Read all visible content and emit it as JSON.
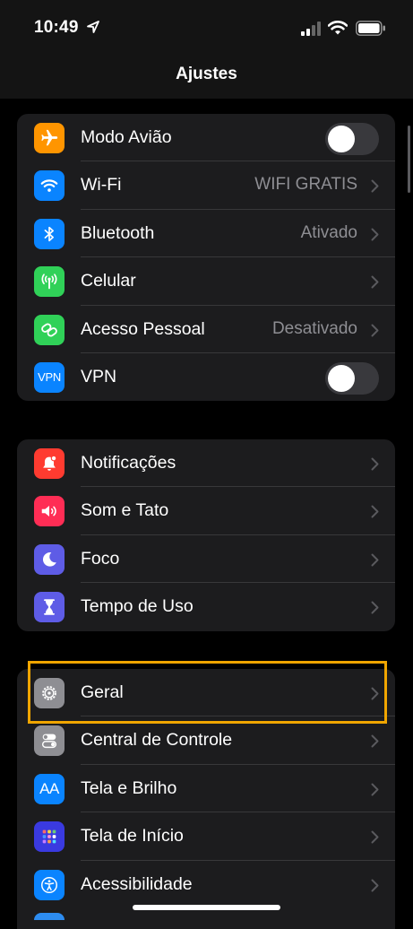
{
  "status_bar": {
    "time": "10:49",
    "icons": [
      "location-arrow-icon",
      "cellular-signal-icon",
      "wifi-status-icon",
      "battery-icon"
    ]
  },
  "nav": {
    "title": "Ajustes"
  },
  "groups": [
    {
      "rows": [
        {
          "label": "Modo Avião",
          "icon": "airplane-icon",
          "icon_color": "#ff9500",
          "control": "toggle",
          "toggle_on": false
        },
        {
          "label": "Wi-Fi",
          "icon": "wifi-icon",
          "icon_color": "#0a84ff",
          "value": "WIFI GRATIS"
        },
        {
          "label": "Bluetooth",
          "icon": "bluetooth-icon",
          "icon_color": "#0a84ff",
          "value": "Ativado"
        },
        {
          "label": "Celular",
          "icon": "antenna-icon",
          "icon_color": "#30d158",
          "value": ""
        },
        {
          "label": "Acesso Pessoal",
          "icon": "hotspot-icon",
          "icon_color": "#30d158",
          "value": "Desativado"
        },
        {
          "label": "VPN",
          "icon": "vpn-icon",
          "icon_text": "VPN",
          "icon_color": "#0a84ff",
          "control": "toggle",
          "toggle_on": false
        }
      ]
    },
    {
      "rows": [
        {
          "label": "Notificações",
          "icon": "bell-icon",
          "icon_color": "#ff3b30"
        },
        {
          "label": "Som e Tato",
          "icon": "speaker-icon",
          "icon_color": "#ff2d55"
        },
        {
          "label": "Foco",
          "icon": "moon-icon",
          "icon_color": "#5e5ce6"
        },
        {
          "label": "Tempo de Uso",
          "icon": "hourglass-icon",
          "icon_color": "#5e5ce6"
        }
      ]
    },
    {
      "rows": [
        {
          "label": "Geral",
          "icon": "gear-icon",
          "icon_color": "#8e8e93"
        },
        {
          "label": "Central de Controle",
          "icon": "switches-icon",
          "icon_color": "#8e8e93"
        },
        {
          "label": "Tela e Brilho",
          "icon": "text-size-icon",
          "icon_text": "AA",
          "icon_color": "#0a84ff"
        },
        {
          "label": "Tela de Início",
          "icon": "home-grid-icon",
          "icon_color": "#3a3ae0"
        },
        {
          "label": "Acessibilidade",
          "icon": "accessibility-icon",
          "icon_color": "#0a84ff"
        }
      ]
    }
  ],
  "highlighted_row": "Geral"
}
